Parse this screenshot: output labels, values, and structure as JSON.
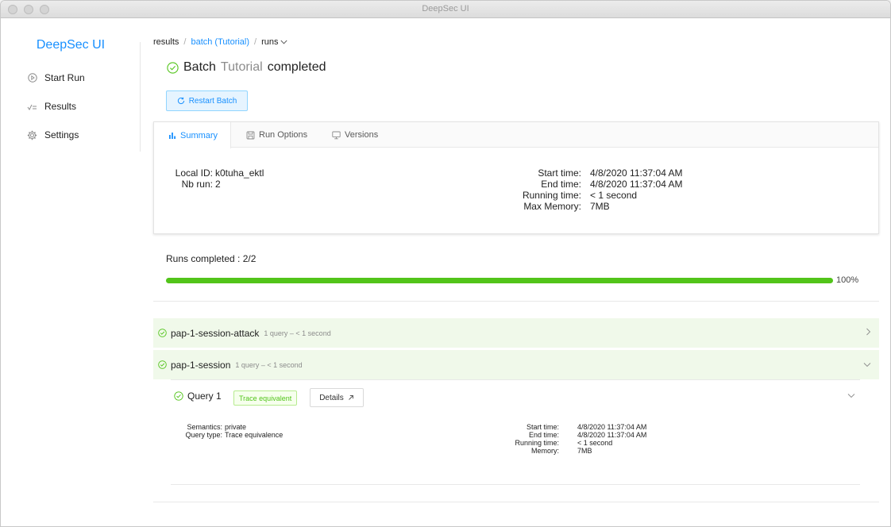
{
  "window": {
    "title": "DeepSec UI"
  },
  "sidebar": {
    "brand": "DeepSec UI",
    "items": [
      {
        "label": "Start Run",
        "icon": "play-circle-icon"
      },
      {
        "label": "Results",
        "icon": "check-list-icon"
      },
      {
        "label": "Settings",
        "icon": "gear-icon"
      }
    ]
  },
  "breadcrumb": {
    "root": "results",
    "sep": "/",
    "batch": "batch (Tutorial)",
    "last": "runs"
  },
  "header": {
    "title_prefix": "Batch",
    "title_name": "Tutorial",
    "title_suffix": "completed",
    "restart_label": "Restart Batch"
  },
  "tabs": [
    {
      "label": "Summary",
      "icon": "bar-chart-icon",
      "active": true
    },
    {
      "label": "Run Options",
      "icon": "save-icon",
      "active": false
    },
    {
      "label": "Versions",
      "icon": "desktop-icon",
      "active": false
    }
  ],
  "summary": {
    "local_id_label": "Local ID:",
    "local_id": "k0tuha_ektl",
    "nb_run_label": "Nb run:",
    "nb_run": "2",
    "start_label": "Start time:",
    "start": "4/8/2020 11:37:04 AM",
    "end_label": "End time:",
    "end": "4/8/2020 11:37:04 AM",
    "running_label": "Running time:",
    "running": "< 1 second",
    "memory_label": "Max Memory:",
    "memory": "7MB"
  },
  "progress": {
    "label": "Runs completed : 2/2",
    "percent_label": "100%",
    "fraction": 1.0
  },
  "runs": [
    {
      "name": "pap-1-session-attack",
      "meta": "1 query – < 1 second",
      "expanded": false
    },
    {
      "name": "pap-1-session",
      "meta": "1 query – < 1 second",
      "expanded": true
    }
  ],
  "query": {
    "title": "Query 1",
    "tag": "Trace equivalent",
    "details_label": "Details",
    "semantics_label": "Semantics:",
    "semantics": "private",
    "type_label": "Query type:",
    "type": "Trace equivalence",
    "start_label": "Start time:",
    "start": "4/8/2020 11:37:04 AM",
    "end_label": "End time:",
    "end": "4/8/2020 11:37:04 AM",
    "running_label": "Running time:",
    "running": "< 1 second",
    "memory_label": "Memory:",
    "memory": "7MB"
  },
  "colors": {
    "accent": "#1890ff",
    "success": "#52c41a",
    "success_bg": "#f0f9ea"
  }
}
